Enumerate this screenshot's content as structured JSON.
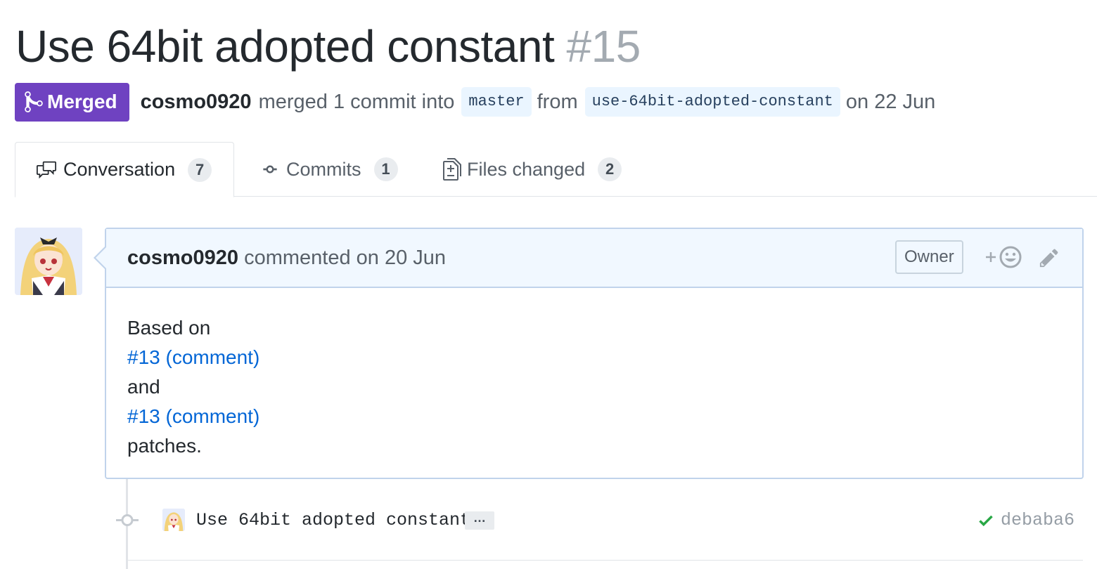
{
  "pr": {
    "title": "Use 64bit adopted constant",
    "number": "#15"
  },
  "meta": {
    "state": "Merged",
    "author": "cosmo0920",
    "action_text": "merged 1 commit into",
    "base_branch": "master",
    "from_text": "from",
    "head_branch": "use-64bit-adopted-constant",
    "date_text": "on 22 Jun"
  },
  "tabs": [
    {
      "label": "Conversation",
      "count": "7",
      "icon": "comment-discussion-icon",
      "selected": true
    },
    {
      "label": "Commits",
      "count": "1",
      "icon": "git-commit-icon",
      "selected": false
    },
    {
      "label": "Files changed",
      "count": "2",
      "icon": "file-diff-icon",
      "selected": false
    }
  ],
  "comment": {
    "author": "cosmo0920",
    "action_text": "commented on 20 Jun",
    "role_label": "Owner",
    "reaction_icon": "add-reaction-icon",
    "edit_icon": "pencil-icon",
    "body": {
      "line1": "Based on",
      "link1": "#13 (comment)",
      "line2": "and",
      "link2": "#13 (comment)",
      "line3": "patches."
    }
  },
  "commit": {
    "message": "Use 64bit adopted constant",
    "expand_label": "…",
    "sha": "debaba6",
    "status_icon": "check-icon"
  },
  "colors": {
    "merged": "#6f42c1",
    "link": "#0366d6",
    "comment_header_bg": "#f1f8ff",
    "comment_border": "#c0d3eb",
    "success": "#28a745"
  }
}
